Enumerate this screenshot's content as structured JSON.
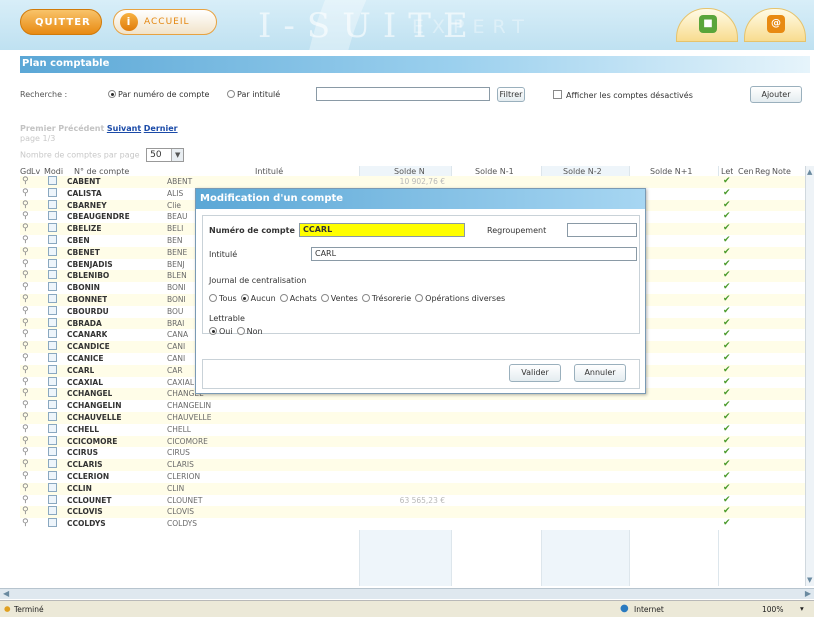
{
  "header": {
    "quit_label": "QUITTER",
    "home_label": "ACCUEIL",
    "brand_main": "I-SUITE",
    "brand_sub": "EXPERT",
    "tab_icons": [
      "book-icon",
      "mail-icon"
    ]
  },
  "page": {
    "title": "Plan comptable"
  },
  "search": {
    "label": "Recherche :",
    "option_number": "Par numéro de compte",
    "option_title": "Par intitulé",
    "selected": "number",
    "input_value": "",
    "filter_button": "Filtrer",
    "show_disabled_label": "Afficher les comptes désactivés",
    "show_disabled_checked": false,
    "add_button": "Ajouter"
  },
  "pager": {
    "first": "Premier",
    "previous": "Précédent",
    "next": "Suivant",
    "last": "Dernier",
    "page_text": "page 1/3",
    "per_page_label": "Nombre de comptes par page",
    "per_page_value": "50"
  },
  "table": {
    "headers": [
      "Gd",
      "Lv",
      "Modi",
      "N° de compte",
      "Intitulé",
      "Solde N",
      "Solde N-1",
      "Solde N-2",
      "Solde N+1",
      "Let",
      "Cen",
      "Reg",
      "Note"
    ],
    "rows": [
      {
        "num": "CABENT",
        "lib": "ABENT",
        "solde": "10 902,76 €",
        "let": true
      },
      {
        "num": "CALISTA",
        "lib": "ALIS",
        "solde": "",
        "let": true
      },
      {
        "num": "CBARNEY",
        "lib": "Clie",
        "solde": "",
        "let": true
      },
      {
        "num": "CBEAUGENDRE",
        "lib": "BEAU",
        "solde": "",
        "let": true
      },
      {
        "num": "CBELIZE",
        "lib": "BELI",
        "solde": "",
        "let": true
      },
      {
        "num": "CBEN",
        "lib": "BEN",
        "solde": "",
        "let": true
      },
      {
        "num": "CBENET",
        "lib": "BENE",
        "solde": "",
        "let": true
      },
      {
        "num": "CBENJADIS",
        "lib": "BENJ",
        "solde": "",
        "let": true
      },
      {
        "num": "CBLENIBO",
        "lib": "BLEN",
        "solde": "",
        "let": true
      },
      {
        "num": "CBONIN",
        "lib": "BONI",
        "solde": "",
        "let": true
      },
      {
        "num": "CBONNET",
        "lib": "BONI",
        "solde": "",
        "let": true
      },
      {
        "num": "CBOURDU",
        "lib": "BOU",
        "solde": "",
        "let": true
      },
      {
        "num": "CBRADA",
        "lib": "BRAI",
        "solde": "",
        "let": true
      },
      {
        "num": "CCANARK",
        "lib": "CANA",
        "solde": "",
        "let": true
      },
      {
        "num": "CCANDICE",
        "lib": "CANI",
        "solde": "",
        "let": true
      },
      {
        "num": "CCANICE",
        "lib": "CANI",
        "solde": "",
        "let": true
      },
      {
        "num": "CCARL",
        "lib": "CAR",
        "solde": "",
        "let": true
      },
      {
        "num": "CCAXIAL",
        "lib": "CAXIAL",
        "solde": "",
        "let": true
      },
      {
        "num": "CCHANGEL",
        "lib": "CHANGEL",
        "solde": "",
        "let": true
      },
      {
        "num": "CCHANGELIN",
        "lib": "CHANGELIN",
        "solde": "",
        "let": true
      },
      {
        "num": "CCHAUVELLE",
        "lib": "CHAUVELLE",
        "solde": "",
        "let": true
      },
      {
        "num": "CCHELL",
        "lib": "CHELL",
        "solde": "",
        "let": true
      },
      {
        "num": "CCICOMORE",
        "lib": "CICOMORE",
        "solde": "",
        "let": true
      },
      {
        "num": "CCIRUS",
        "lib": "CIRUS",
        "solde": "",
        "let": true
      },
      {
        "num": "CCLARIS",
        "lib": "CLARIS",
        "solde": "",
        "let": true
      },
      {
        "num": "CCLERION",
        "lib": "CLERION",
        "solde": "",
        "let": true
      },
      {
        "num": "CCLIN",
        "lib": "CLIN",
        "solde": "",
        "let": true
      },
      {
        "num": "CCLOUNET",
        "lib": "CLOUNET",
        "solde": "63 565,23 €",
        "let": true
      },
      {
        "num": "CCLOVIS",
        "lib": "CLOVIS",
        "solde": "",
        "let": true
      },
      {
        "num": "CCOLDYS",
        "lib": "COLDYS",
        "solde": "",
        "let": true
      }
    ]
  },
  "modal": {
    "title": "Modification d'un compte",
    "account_label": "Numéro de compte",
    "account_value": "CCARL",
    "group_label": "Regroupement",
    "group_value": "",
    "title_label": "Intitulé",
    "title_value": "CARL",
    "journal_label": "Journal de centralisation",
    "journal_options": [
      "Tous",
      "Aucun",
      "Achats",
      "Ventes",
      "Trésorerie",
      "Opérations diverses"
    ],
    "journal_selected": "Aucun",
    "lettrable_label": "Lettrable",
    "lettrable_options": [
      "Oui",
      "Non"
    ],
    "lettrable_selected": "Oui",
    "validate_button": "Valider",
    "cancel_button": "Annuler"
  },
  "statusbar": {
    "left_text": "Terminé",
    "zone": "Internet",
    "zoom": "100%"
  },
  "colors": {
    "accent_orange": "#e88a12",
    "title_blue": "#5ba7d6",
    "highlight_yellow": "#ffff00",
    "check_green": "#4a9a2a"
  }
}
